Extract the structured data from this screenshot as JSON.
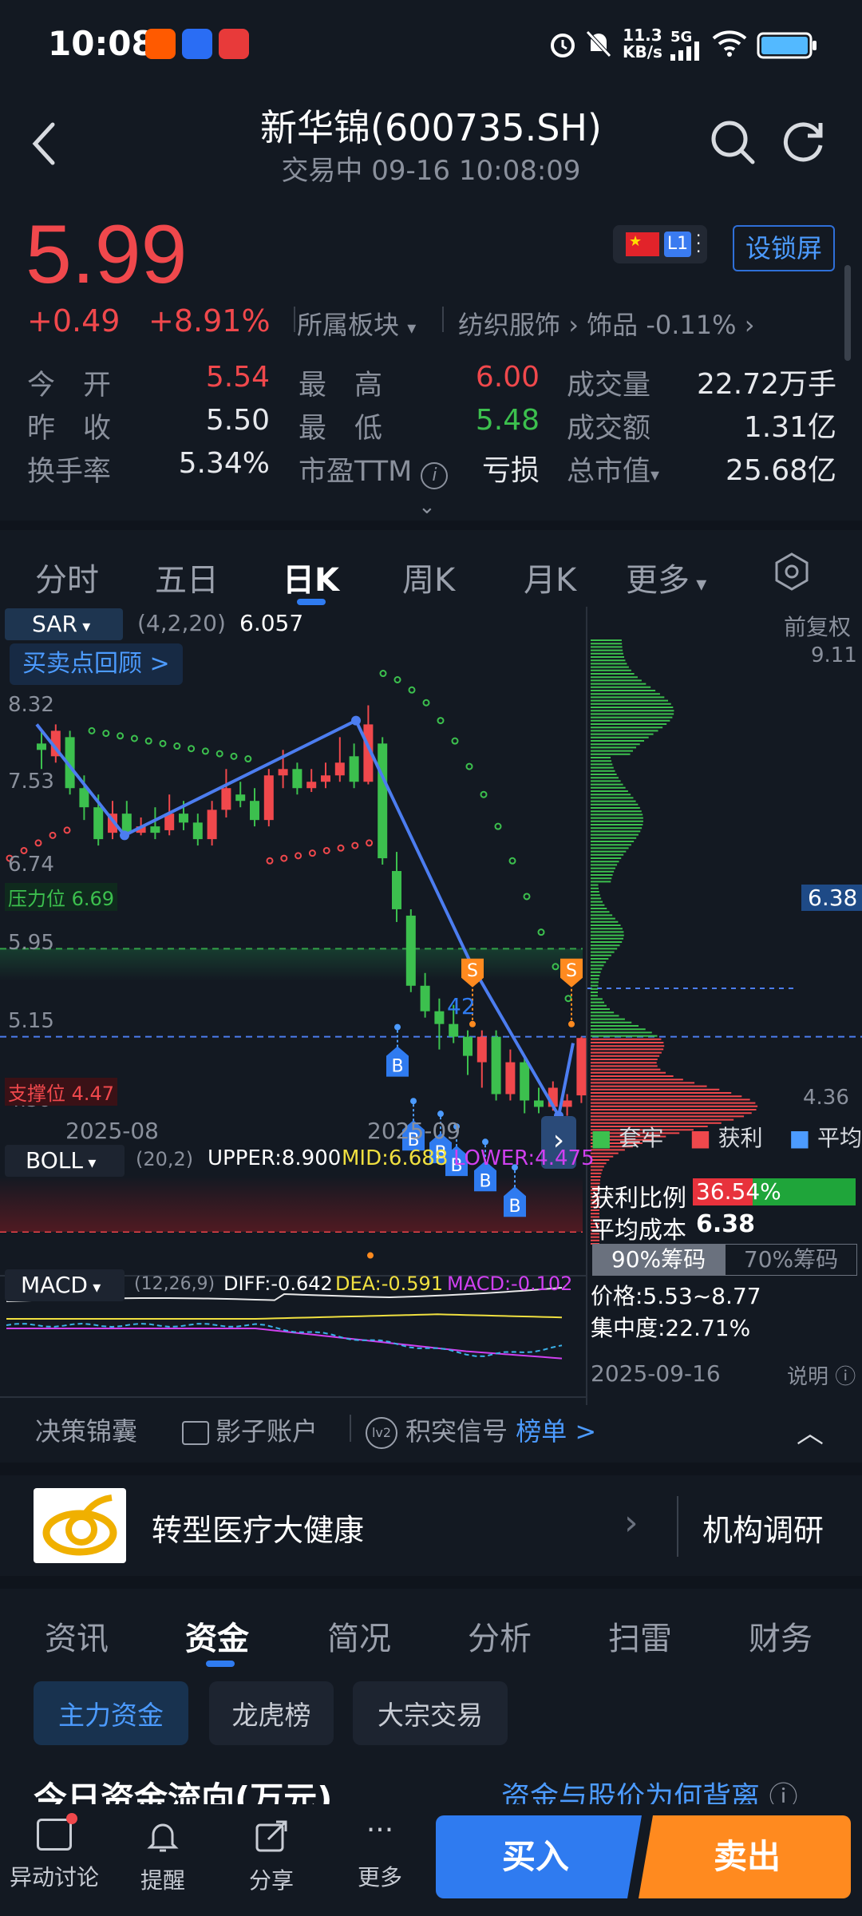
{
  "status": {
    "time": "10:08",
    "net_speed_value": "11.3",
    "net_speed_unit": "KB/s",
    "network": "5G"
  },
  "header": {
    "title": "新华锦(600735.SH)",
    "subtitle": "交易中 09-16 10:08:09"
  },
  "quote": {
    "price": "5.99",
    "change": "+0.49",
    "change_pct": "+8.91%",
    "sector_label": "所属板块",
    "sector_name": "纺织服饰",
    "sector_sub": "饰品 -0.11%",
    "market_badge": "L1",
    "lock_button": "设锁屏",
    "stats": {
      "open_label": "今　开",
      "open": "5.54",
      "high_label": "最　高",
      "high": "6.00",
      "volume_label": "成交量",
      "volume": "22.72万手",
      "prev_close_label": "昨　收",
      "prev_close": "5.50",
      "low_label": "最　低",
      "low": "5.48",
      "amount_label": "成交额",
      "amount": "1.31亿",
      "turnover_label": "换手率",
      "turnover": "5.34%",
      "pe_label": "市盈TTM",
      "pe": "亏损",
      "mktcap_label": "总市值",
      "mktcap": "25.68亿"
    }
  },
  "chart_tabs": {
    "t1": "分时",
    "t2": "五日",
    "t3": "日K",
    "t4": "周K",
    "t5": "月K",
    "t6": "更多"
  },
  "kline": {
    "indicator": "SAR",
    "params": "(4,2,20)",
    "value": "6.057",
    "review_button": "买卖点回顾 >",
    "adjust": "前复权",
    "y_labels": {
      "l1": "8.32",
      "l2": "7.53",
      "l3": "6.74",
      "l4": "5.95",
      "l5": "5.15",
      "l6": "4.36"
    },
    "pressure": "压力位 6.69",
    "support": "支撑位 4.47",
    "x_labels": {
      "a": "2025-08",
      "b": "2025-09"
    },
    "mid_marker": "42"
  },
  "boll": {
    "name": "BOLL",
    "params": "(20,2)",
    "upper": "UPPER:8.900",
    "mid": "MID:6.688",
    "lower": "LOWER:4.475"
  },
  "macd": {
    "name": "MACD",
    "params": "(12,26,9)",
    "diff": "DIFF:-0.642",
    "dea": "DEA:-0.591",
    "macd": "MACD:-0.102"
  },
  "chip": {
    "top": "9.11",
    "bottom": "4.36",
    "avg_tag": "6.38",
    "legend": {
      "trapped": "套牢",
      "profit": "获利",
      "avg": "平均"
    },
    "profit_ratio_label": "获利比例",
    "profit_ratio": "36.54%",
    "profit_fraction": 0.3654,
    "avg_cost_label": "平均成本",
    "avg_cost": "6.38",
    "tab90": "90%筹码",
    "tab70": "70%筹码",
    "price_range": "价格:5.53~8.77",
    "concentration": "集中度:22.71%",
    "date": "2025-09-16",
    "help": "说明"
  },
  "tools": {
    "t1": "决策锦囊",
    "t2": "影子账户",
    "t3": "积突信号",
    "t4": "榜单 >"
  },
  "topic": {
    "text": "转型医疗大健康",
    "right": "机构调研"
  },
  "info_tabs": {
    "t1": "资讯",
    "t2": "资金",
    "t3": "简况",
    "t4": "分析",
    "t5": "扫雷",
    "t6": "财务"
  },
  "sub_tabs": {
    "s1": "主力资金",
    "s2": "龙虎榜",
    "s3": "大宗交易"
  },
  "flow": {
    "title": "今日资金流向(万元)",
    "link": "资金与股价为何背离"
  },
  "footer": {
    "f1": "异动讨论",
    "f2": "提醒",
    "f3": "分享",
    "f4": "更多",
    "buy": "买入",
    "sell": "卖出"
  },
  "colors": {
    "up": "#f0484c",
    "down": "#3cc04e",
    "accent": "#2f7bf0",
    "sell": "#ff8a1f",
    "bg": "#131922"
  }
}
